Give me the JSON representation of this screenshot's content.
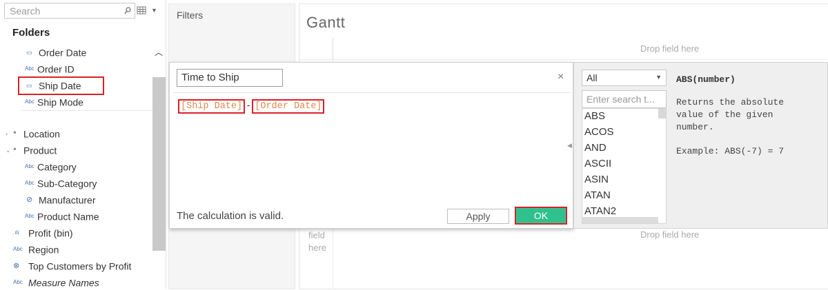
{
  "data_pane": {
    "search_placeholder": "Search",
    "folders_title": "Folders",
    "fields": [
      {
        "icon": "calendar-icon",
        "glyph": "📅",
        "label": "Order Date"
      },
      {
        "icon": "abc-icon",
        "glyph": "Abc",
        "label": "Order ID"
      },
      {
        "icon": "calendar-icon",
        "glyph": "📅",
        "label": "Ship Date"
      },
      {
        "icon": "abc-icon",
        "glyph": "Abc",
        "label": "Ship Mode"
      },
      {
        "icon": "hierarchy-icon",
        "glyph": "⛬",
        "label": "Location"
      },
      {
        "icon": "hierarchy-icon",
        "glyph": "⛬",
        "label": "Product"
      },
      {
        "icon": "abc-icon",
        "glyph": "Abc",
        "label": "Category"
      },
      {
        "icon": "abc-icon",
        "glyph": "Abc",
        "label": "Sub-Category"
      },
      {
        "icon": "paperclip-icon",
        "glyph": "⚲",
        "label": "Manufacturer"
      },
      {
        "icon": "abc-icon",
        "glyph": "Abc",
        "label": "Product Name"
      },
      {
        "icon": "histogram-icon",
        "glyph": "ılı",
        "label": "Profit (bin)"
      },
      {
        "icon": "abc-icon",
        "glyph": "Abc",
        "label": "Region"
      },
      {
        "icon": "set-icon",
        "glyph": "⊘",
        "label": "Top Customers by Profit"
      },
      {
        "icon": "abc-icon",
        "glyph": "Abc",
        "label": "Measure Names"
      }
    ]
  },
  "filters": {
    "label": "Filters"
  },
  "view": {
    "title": "Gantt",
    "drop_top": "Drop field here",
    "drop_left": "field here",
    "drop_bottom": "Drop field here"
  },
  "calc_dialog": {
    "name": "Time to Ship",
    "formula": {
      "token1": "[Ship Date]",
      "operator": "-",
      "token2": "[Order Date]"
    },
    "status": "The calculation is valid.",
    "apply_label": "Apply",
    "ok_label": "OK",
    "close_glyph": "×"
  },
  "functions": {
    "category": "All",
    "search_placeholder": "Enter search t...",
    "list": [
      "ABS",
      "ACOS",
      "AND",
      "ASCII",
      "ASIN",
      "ATAN",
      "ATAN2"
    ],
    "signature": "ABS(number)",
    "description": "Returns the absolute value of the given number.",
    "example": "Example: ABS(-7) = 7"
  },
  "colors": {
    "highlight_red": "#d92027",
    "ok_green": "#2fc08e",
    "field_token_orange": "#e4864b"
  }
}
